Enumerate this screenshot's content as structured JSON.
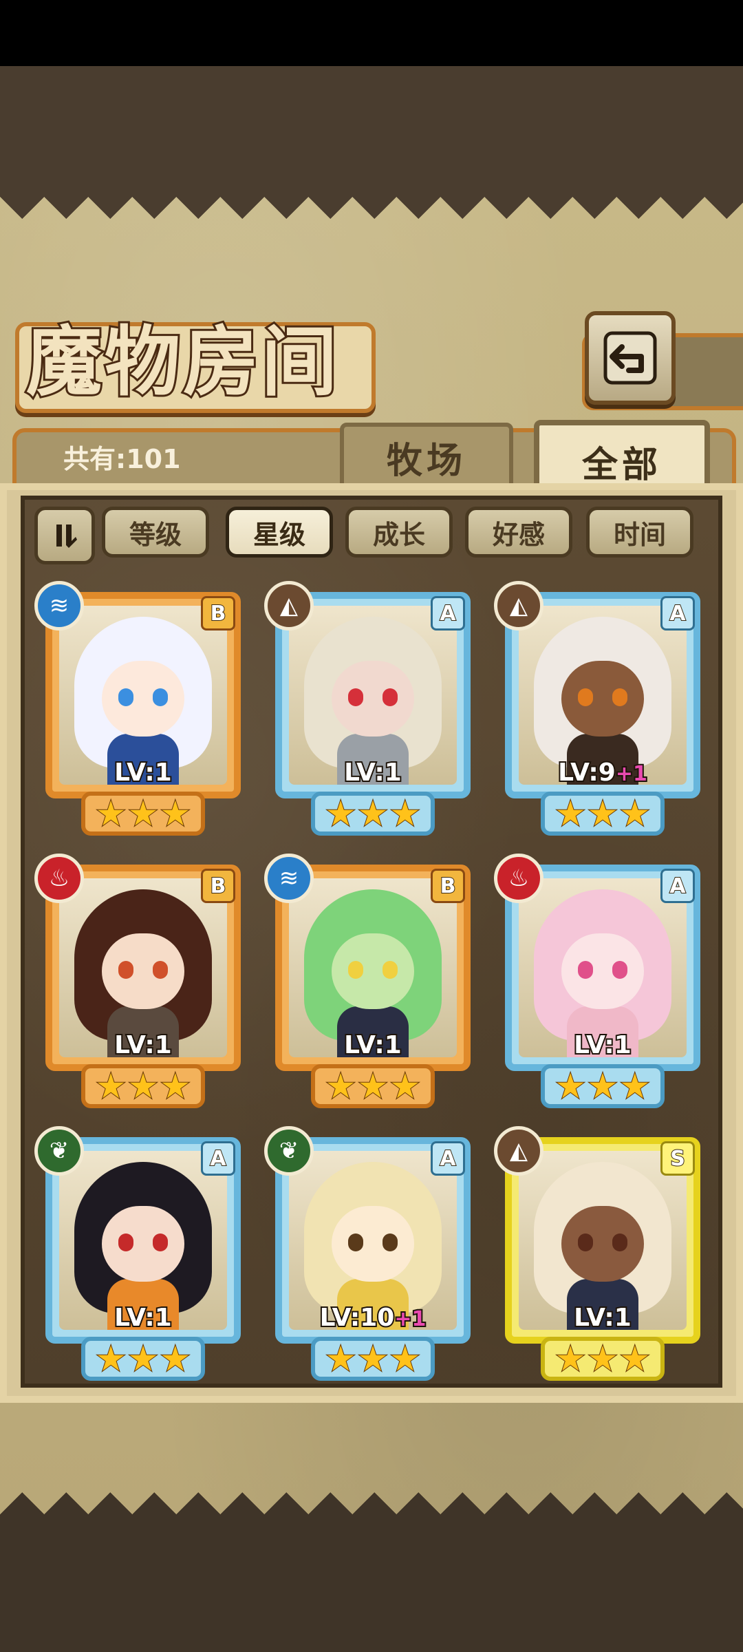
{
  "title": "魔物房间",
  "total_label": "共有:101",
  "tabs": [
    {
      "label": "牧场",
      "active": false
    },
    {
      "label": "全部",
      "active": true
    }
  ],
  "sort_buttons": [
    {
      "label": "等级",
      "active": false
    },
    {
      "label": "星级",
      "active": true
    },
    {
      "label": "成长",
      "active": false
    },
    {
      "label": "好感",
      "active": false
    },
    {
      "label": "时间",
      "active": false
    }
  ],
  "icons": {
    "back": "back-arrow-icon",
    "sort_toggle": "sort-order-icon",
    "star": "★",
    "element": {
      "water": "≋",
      "earth": "◭",
      "fire": "♨",
      "grass": "❦"
    }
  },
  "colors": {
    "rank_b": "#e08a2a",
    "rank_a": "#67b6dc",
    "rank_s": "#e6d21d",
    "water": "#2a7fc9",
    "earth": "#6b4a30",
    "fire": "#c9222a",
    "grass": "#2f6a2e"
  },
  "monsters": [
    {
      "rank": "B",
      "element": "water",
      "level": "LV:1",
      "plus": "",
      "stars": 3,
      "hair": "#f2f3ff",
      "skin": "#fde9dc",
      "eye": "#3b8fe0",
      "outfit": "#2b4f9a"
    },
    {
      "rank": "A",
      "element": "earth",
      "level": "LV:1",
      "plus": "",
      "stars": 3,
      "hair": "#e9e2cf",
      "skin": "#f1d9cf",
      "eye": "#d5303a",
      "outfit": "#9aa0a6"
    },
    {
      "rank": "A",
      "element": "earth",
      "level": "LV:9",
      "plus": "+1",
      "stars": 3,
      "hair": "#efe9e3",
      "skin": "#8a5a3a",
      "eye": "#e07a1e",
      "outfit": "#3a2a20"
    },
    {
      "rank": "B",
      "element": "fire",
      "level": "LV:1",
      "plus": "",
      "stars": 3,
      "hair": "#4a2418",
      "skin": "#f6dcc8",
      "eye": "#d0502a",
      "outfit": "#5a4a3e"
    },
    {
      "rank": "B",
      "element": "water",
      "level": "LV:1",
      "plus": "",
      "stars": 3,
      "hair": "#7ed37a",
      "skin": "#c6e8a9",
      "eye": "#f0d040",
      "outfit": "#2a2e44"
    },
    {
      "rank": "A",
      "element": "fire",
      "level": "LV:1",
      "plus": "",
      "stars": 3,
      "hair": "#f5c6d8",
      "skin": "#fbe4e6",
      "eye": "#e0508a",
      "outfit": "#f0b8c8"
    },
    {
      "rank": "A",
      "element": "grass",
      "level": "LV:1",
      "plus": "",
      "stars": 3,
      "hair": "#1e1a22",
      "skin": "#f6dccc",
      "eye": "#c52a2a",
      "outfit": "#e8892a"
    },
    {
      "rank": "A",
      "element": "grass",
      "level": "LV:10",
      "plus": "+1",
      "stars": 3,
      "hair": "#f1e3b2",
      "skin": "#fcebd2",
      "eye": "#5a3a1a",
      "outfit": "#e9c64a"
    },
    {
      "rank": "S",
      "element": "earth",
      "level": "LV:1",
      "plus": "",
      "stars": 3,
      "hair": "#f2e6cf",
      "skin": "#8a5a3e",
      "eye": "#5a2a1a",
      "outfit": "#2a3048"
    }
  ]
}
